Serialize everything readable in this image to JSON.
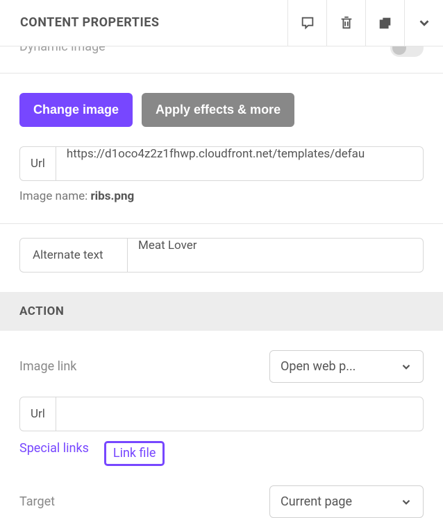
{
  "header": {
    "title": "CONTENT PROPERTIES"
  },
  "dynamic": {
    "label": "Dynamic image"
  },
  "buttons": {
    "change_image": "Change image",
    "apply_effects": "Apply effects & more"
  },
  "url_section": {
    "prefix": "Url",
    "value": "https://d1oco4z2z1fhwp.cloudfront.net/templates/defau",
    "image_name_label": "Image name:",
    "image_name_value": "ribs.png"
  },
  "alt_text": {
    "label": "Alternate text",
    "value": "Meat Lover"
  },
  "action": {
    "heading": "ACTION",
    "image_link_label": "Image link",
    "image_link_value": "Open web p...",
    "url_prefix": "Url",
    "url_value": "",
    "special_links": "Special links",
    "link_file": "Link file",
    "target_label": "Target",
    "target_value": "Current page"
  }
}
